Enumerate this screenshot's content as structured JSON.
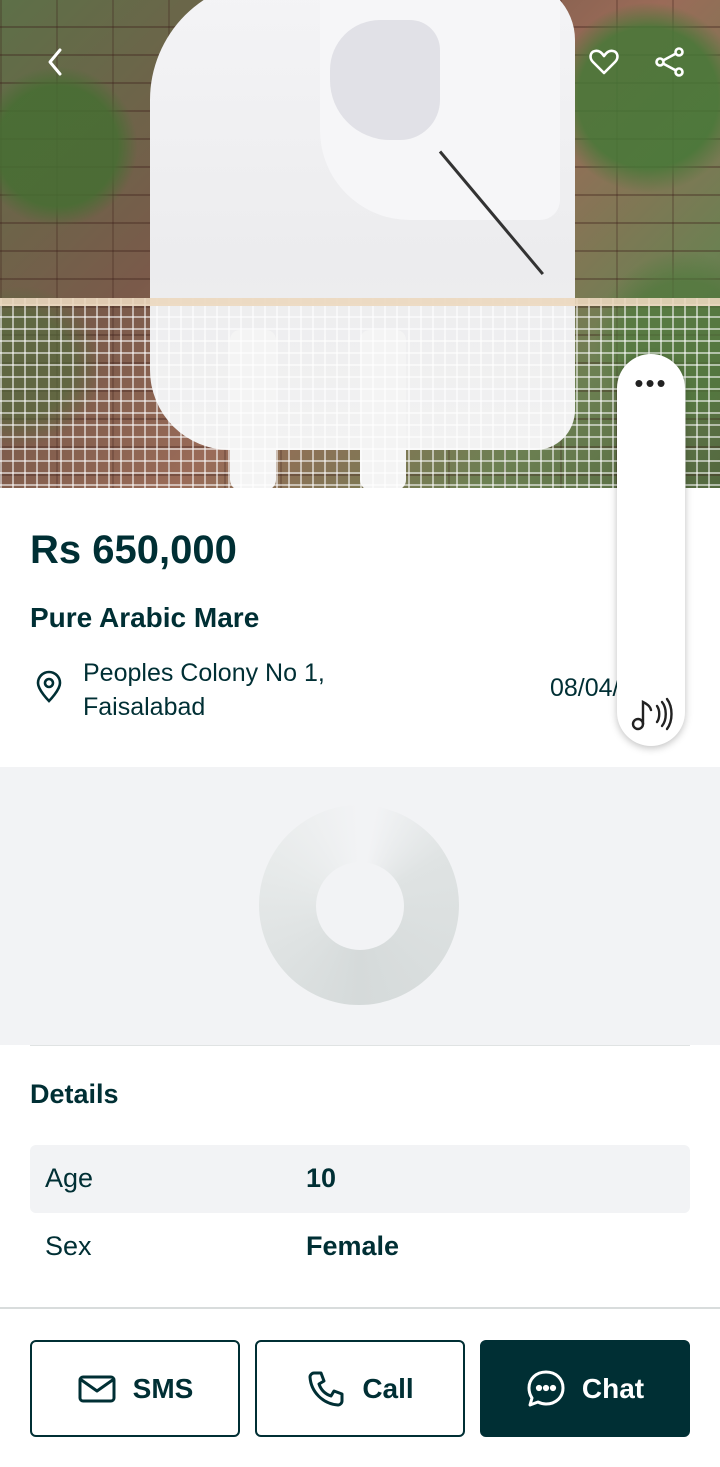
{
  "listing": {
    "price": "Rs 650,000",
    "title": "Pure Arabic Mare",
    "location_line1": "Peoples Colony No 1,",
    "location_line2": "Faisalabad",
    "date": "08/04/25"
  },
  "header": {
    "back_icon": "chevron-left-icon",
    "favorite_icon": "heart-icon",
    "share_icon": "share-icon"
  },
  "details": {
    "heading": "Details",
    "rows": [
      {
        "key": "Age",
        "value": "10"
      },
      {
        "key": "Sex",
        "value": "Female"
      }
    ]
  },
  "actions": {
    "sms_label": "SMS",
    "call_label": "Call",
    "chat_label": "Chat"
  },
  "overlay": {
    "menu_dots": "•••",
    "audio_icon": "music-note-icon"
  },
  "colors": {
    "primary": "#002f34",
    "background_gray": "#f2f3f5"
  }
}
